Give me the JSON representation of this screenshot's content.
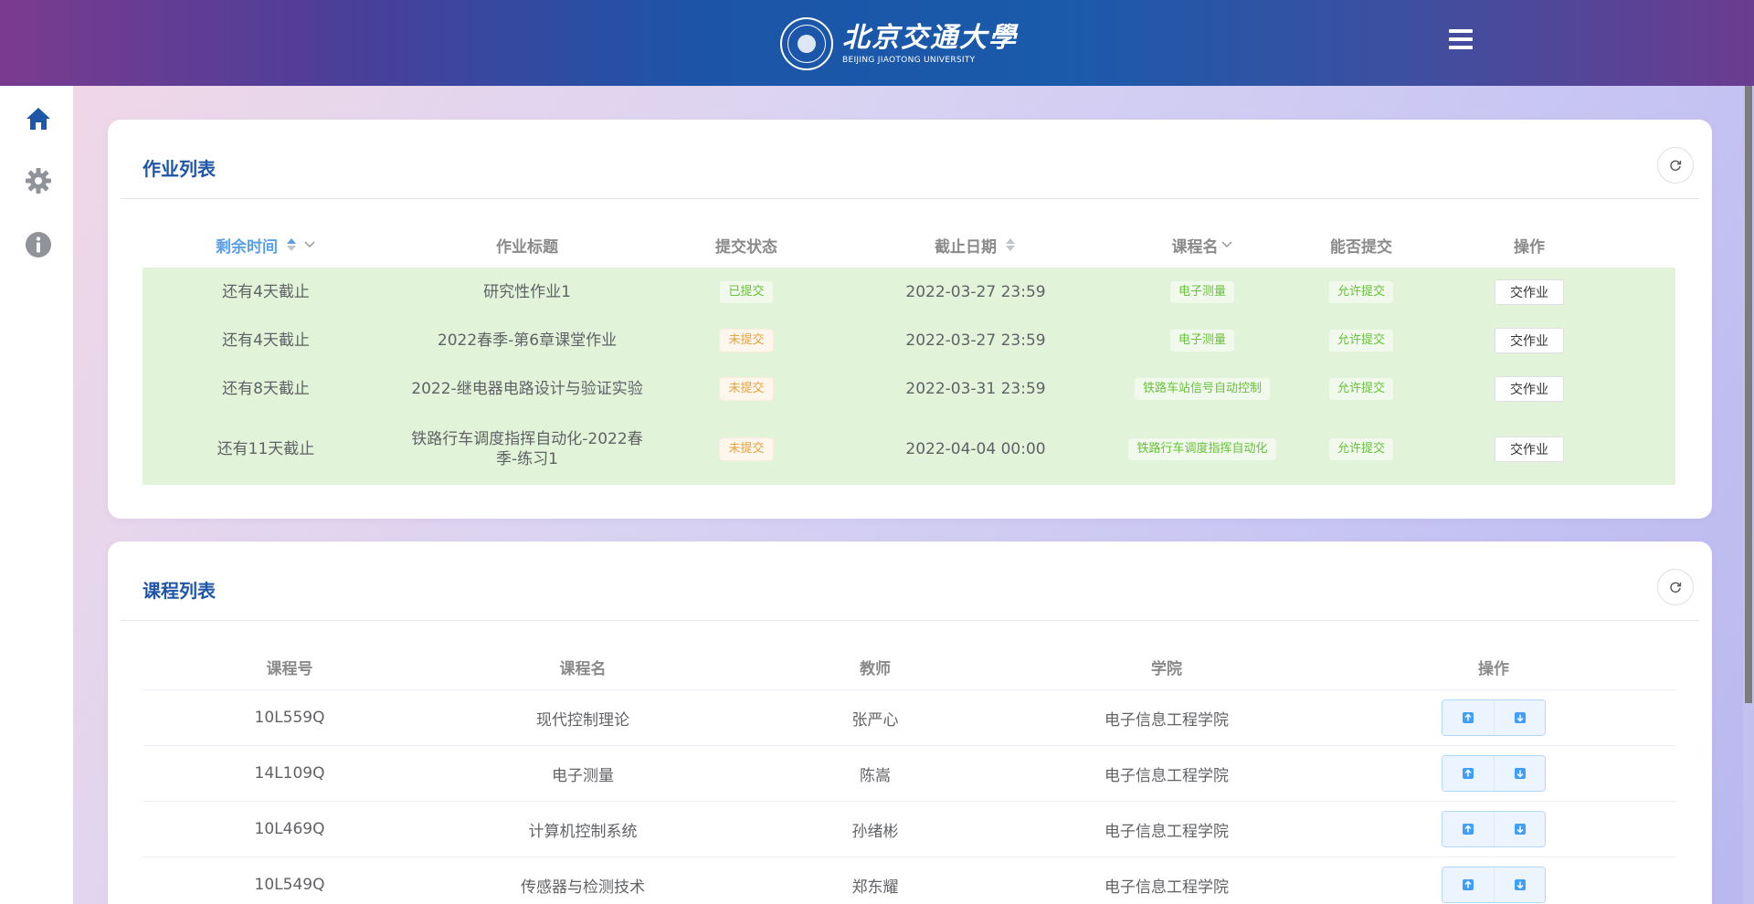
{
  "header": {
    "logo_cn": "北京交通大學",
    "logo_en": "BEIJING JIAOTONG UNIVERSITY"
  },
  "sidebar": {
    "items": [
      {
        "icon": "home-icon",
        "color": "#1f56a8"
      },
      {
        "icon": "gear-icon",
        "color": "#909399"
      },
      {
        "icon": "info-icon",
        "color": "#909399"
      }
    ]
  },
  "homework": {
    "title": "作业列表",
    "headers": {
      "remaining": "剩余时间",
      "title": "作业标题",
      "status": "提交状态",
      "deadline": "截止日期",
      "course": "课程名",
      "can_submit": "能否提交",
      "action": "操作"
    },
    "rows": [
      {
        "remaining": "还有4天截止",
        "title": "研究性作业1",
        "status": "已提交",
        "status_type": "success",
        "deadline": "2022-03-27 23:59",
        "course": "电子测量",
        "can_submit": "允许提交",
        "action": "交作业"
      },
      {
        "remaining": "还有4天截止",
        "title": "2022春季-第6章课堂作业",
        "status": "未提交",
        "status_type": "warning",
        "deadline": "2022-03-27 23:59",
        "course": "电子测量",
        "can_submit": "允许提交",
        "action": "交作业"
      },
      {
        "remaining": "还有8天截止",
        "title": "2022-继电器电路设计与验证实验",
        "status": "未提交",
        "status_type": "warning",
        "deadline": "2022-03-31 23:59",
        "course": "铁路车站信号自动控制",
        "can_submit": "允许提交",
        "action": "交作业"
      },
      {
        "remaining": "还有11天截止",
        "title": "铁路行车调度指挥自动化-2022春季-练习1",
        "status": "未提交",
        "status_type": "warning",
        "deadline": "2022-04-04 00:00",
        "course": "铁路行车调度指挥自动化",
        "can_submit": "允许提交",
        "action": "交作业"
      }
    ]
  },
  "courses": {
    "title": "课程列表",
    "headers": {
      "code": "课程号",
      "name": "课程名",
      "teacher": "教师",
      "school": "学院",
      "action": "操作"
    },
    "rows": [
      {
        "code": "10L559Q",
        "name": "现代控制理论",
        "teacher": "张严心",
        "school": "电子信息工程学院"
      },
      {
        "code": "14L109Q",
        "name": "电子测量",
        "teacher": "陈嵩",
        "school": "电子信息工程学院"
      },
      {
        "code": "10L469Q",
        "name": "计算机控制系统",
        "teacher": "孙绪彬",
        "school": "电子信息工程学院"
      },
      {
        "code": "10L549Q",
        "name": "传感器与检测技术",
        "teacher": "郑东耀",
        "school": "电子信息工程学院"
      }
    ]
  },
  "colors": {
    "accent": "#1f56a8",
    "row_highlight": "#e1f3d8",
    "success": "#67c23a",
    "warning": "#e6a23c",
    "primary_button": "#409eff"
  }
}
